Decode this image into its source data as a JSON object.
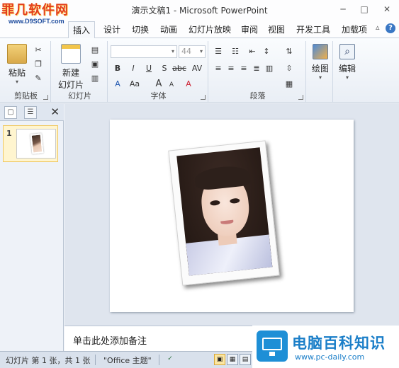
{
  "watermark_top": {
    "title": "罪几软件网",
    "url": "www.D9SOFT.com"
  },
  "titlebar": {
    "title": "演示文稿1 - Microsoft PowerPoint",
    "minimize": "─",
    "maximize": "□",
    "close": "✕"
  },
  "tabs": [
    "插入",
    "设计",
    "切换",
    "动画",
    "幻灯片放映",
    "审阅",
    "视图",
    "开发工具",
    "加载项"
  ],
  "active_tab": "插入",
  "tabs_right": {
    "collapse": "▵",
    "help": "?"
  },
  "ribbon": {
    "clipboard": {
      "label": "剪贴板",
      "paste": "粘贴"
    },
    "slides": {
      "label": "幻灯片",
      "new_slide_line1": "新建",
      "new_slide_line2": "幻灯片"
    },
    "font": {
      "label": "字体",
      "font_name": "",
      "font_size": "44",
      "bold": "B",
      "italic": "I",
      "underline": "U",
      "shadow": "S",
      "strike": "abc",
      "spacing": "AV",
      "case": "Aa",
      "grow": "A",
      "shrink": "A",
      "clear": "A"
    },
    "paragraph": {
      "label": "段落"
    },
    "drawing": {
      "label": "绘图"
    },
    "editing": {
      "label": "编辑"
    }
  },
  "left_panel": {
    "slide_number": "1",
    "close": "✕"
  },
  "notes": {
    "placeholder": "单击此处添加备注"
  },
  "status": {
    "slide_info": "幻灯片 第 1 张，共 1 张",
    "theme": "\"Office 主题\""
  },
  "watermark_bottom": {
    "title": "电脑百科知识",
    "url": "www.pc-daily.com"
  },
  "colors": {
    "ribbon_bg": "#eef2f8",
    "accent_blue": "#1a7ec8",
    "watermark_red": "#e33d1c"
  }
}
